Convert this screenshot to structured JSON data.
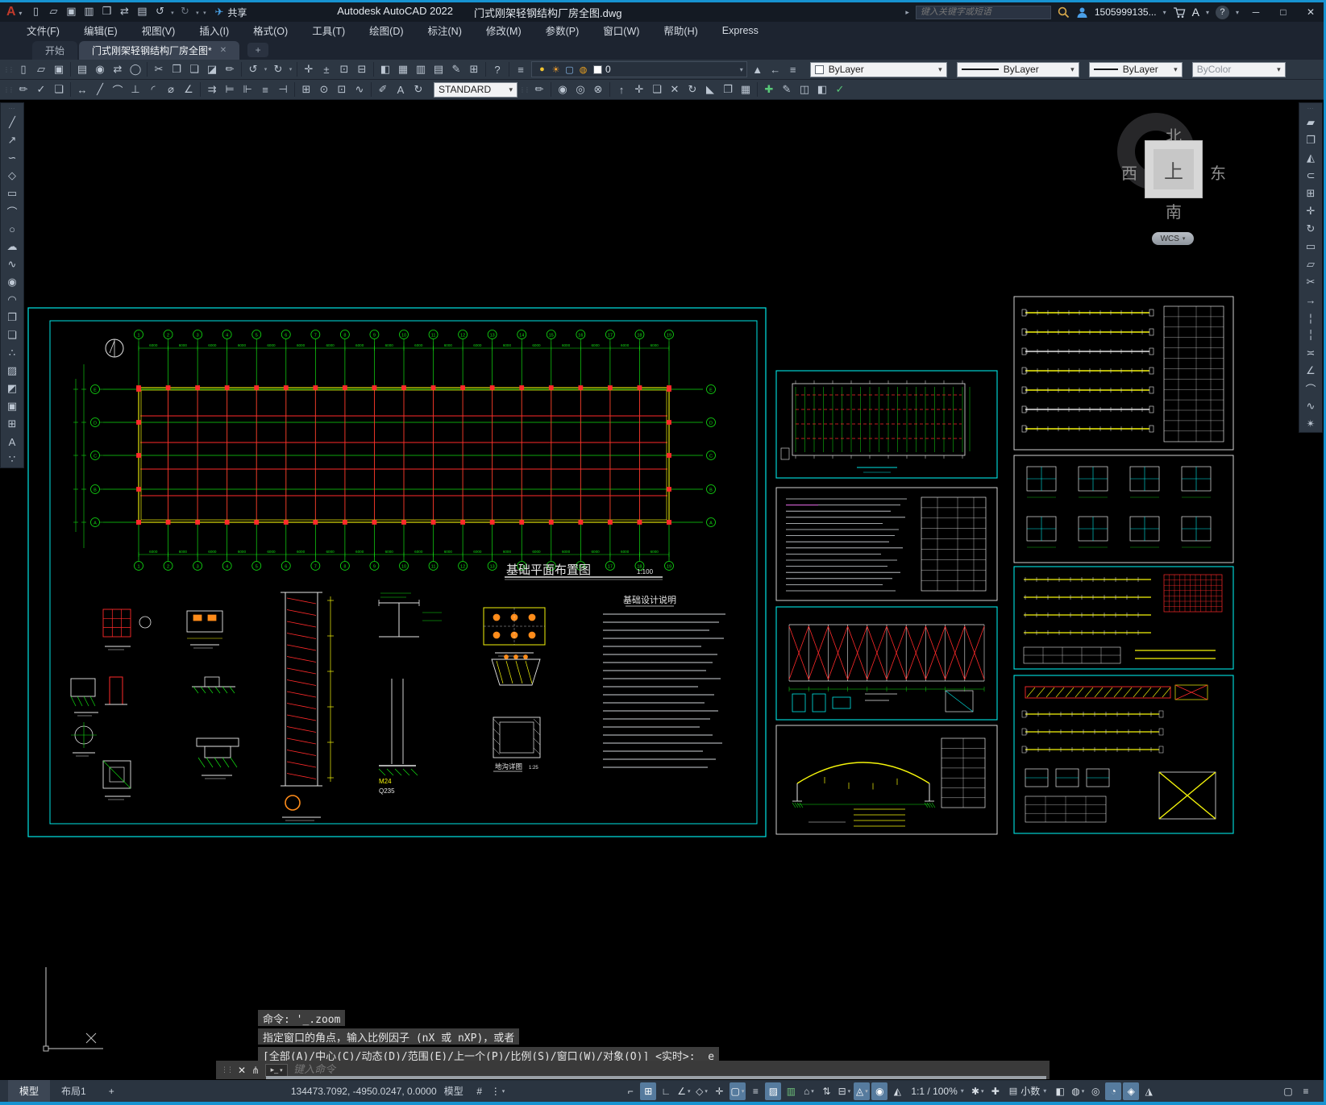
{
  "app": {
    "title": "Autodesk AutoCAD 2022",
    "file": "门式刚架轻钢结构厂房全图.dwg",
    "logo_letter": "A"
  },
  "titlebar": {
    "search_placeholder": "键入关键字或短语",
    "username": "1505999135...",
    "share_label": "共享",
    "minimize": "─",
    "maximize": "□",
    "close": "✕",
    "qat": [
      {
        "n": "qnew",
        "g": "▯"
      },
      {
        "n": "open",
        "g": "▱"
      },
      {
        "n": "qsave",
        "g": "▣"
      },
      {
        "n": "save-as",
        "g": "▥"
      },
      {
        "n": "save-to-web",
        "g": "❒"
      },
      {
        "n": "open-from-mobile",
        "g": "⇄"
      },
      {
        "n": "plot",
        "g": "▤"
      },
      {
        "n": "undo",
        "g": "↺"
      },
      {
        "n": "undo-list",
        "g": "▾",
        "sm": 1
      },
      {
        "n": "redo",
        "g": "↻",
        "c": "#6a7480"
      },
      {
        "n": "redo-list",
        "g": "▾",
        "sm": 1
      },
      {
        "n": "customize-qat",
        "g": "▾",
        "sm": 1
      }
    ]
  },
  "menu": {
    "items": [
      "文件(F)",
      "编辑(E)",
      "视图(V)",
      "插入(I)",
      "格式(O)",
      "工具(T)",
      "绘图(D)",
      "标注(N)",
      "修改(M)",
      "参数(P)",
      "窗口(W)",
      "帮助(H)",
      "Express"
    ]
  },
  "file_tabs": {
    "start": "开始",
    "doc": "门式刚架轻钢结构厂房全图*",
    "close": "✕",
    "new": "+"
  },
  "ribbon": {
    "groups1": [
      {
        "name": "file",
        "icons": [
          {
            "n": "qnew",
            "g": "▯"
          },
          {
            "n": "open",
            "g": "▱"
          },
          {
            "n": "qsave",
            "g": "▣"
          }
        ]
      },
      {
        "name": "plot",
        "icons": [
          {
            "n": "plot",
            "g": "▤"
          },
          {
            "n": "plot-preview",
            "g": "◉"
          },
          {
            "n": "publish",
            "g": "⇄"
          },
          {
            "n": "web-publish",
            "g": "◯"
          }
        ]
      },
      {
        "name": "clipboard",
        "icons": [
          {
            "n": "cut",
            "g": "✂"
          },
          {
            "n": "copy-clip",
            "g": "❐"
          },
          {
            "n": "paste",
            "g": "❏"
          },
          {
            "n": "paste-block",
            "g": "◪"
          },
          {
            "n": "match-properties",
            "g": "✏"
          }
        ]
      },
      {
        "name": "undo-redo",
        "icons": [
          {
            "n": "undo",
            "g": "↺"
          },
          {
            "n": "undo-list",
            "g": "▾",
            "sm": 1
          },
          {
            "n": "redo",
            "g": "↻"
          },
          {
            "n": "redo-list",
            "g": "▾",
            "sm": 1
          }
        ]
      },
      {
        "name": "navigate",
        "icons": [
          {
            "n": "pan",
            "g": "✛"
          },
          {
            "n": "zoom-realtime",
            "g": "±"
          },
          {
            "n": "zoom-window",
            "g": "⊡"
          },
          {
            "n": "zoom-previous",
            "g": "⊟"
          }
        ]
      },
      {
        "name": "palettes",
        "icons": [
          {
            "n": "properties",
            "g": "◧"
          },
          {
            "n": "design-center",
            "g": "▦"
          },
          {
            "n": "tool-palettes",
            "g": "▥"
          },
          {
            "n": "sheet-set-manager",
            "g": "▤"
          },
          {
            "n": "markup",
            "g": "✎"
          },
          {
            "n": "quick-calc",
            "g": "⊞"
          }
        ]
      },
      {
        "name": "help",
        "icons": [
          {
            "n": "help",
            "g": "?"
          }
        ]
      },
      {
        "name": "layer",
        "icons": [
          {
            "n": "layer-properties",
            "g": "≡"
          }
        ]
      }
    ],
    "layer_chip": {
      "icons": [
        {
          "n": "layer-on",
          "g": "●",
          "c": "#f0c330"
        },
        {
          "n": "layer-sun",
          "g": "☀",
          "c": "#f0a030"
        },
        {
          "n": "layer-vp-freeze",
          "g": "▢",
          "c": "#86b7e8"
        },
        {
          "n": "layer-lock",
          "g": "◍",
          "c": "#e8a020"
        }
      ],
      "value": "0"
    },
    "layer_tools": [
      {
        "n": "make-object-layer-current",
        "g": "▲"
      },
      {
        "n": "layer-previous",
        "g": "←"
      },
      {
        "n": "layer-states",
        "g": "≡"
      }
    ],
    "color_value": "ByLayer",
    "linetype_value": "ByLayer",
    "lineweight_value": "ByLayer",
    "plot_style_value": "ByColor",
    "text_style": "STANDARD",
    "groups2": [
      {
        "name": "text",
        "icons": [
          {
            "n": "edit-text",
            "g": "✏"
          },
          {
            "n": "spell-check",
            "g": "✓"
          },
          {
            "n": "layer-match",
            "g": "❏"
          }
        ]
      },
      {
        "name": "dimension",
        "icons": [
          {
            "n": "dim-linear",
            "g": "↔"
          },
          {
            "n": "dim-aligned",
            "g": "╱"
          },
          {
            "n": "dim-arc-length",
            "g": "⌒"
          },
          {
            "n": "dim-ordinate",
            "g": "⊥"
          },
          {
            "n": "dim-radius",
            "g": "◜"
          },
          {
            "n": "dim-diameter",
            "g": "⌀"
          },
          {
            "n": "dim-angular",
            "g": "∠"
          }
        ]
      },
      {
        "name": "dim-tools",
        "icons": [
          {
            "n": "quick-dim",
            "g": "⇉"
          },
          {
            "n": "dim-baseline",
            "g": "⊨"
          },
          {
            "n": "dim-continue",
            "g": "⊩"
          },
          {
            "n": "dim-space",
            "g": "≡"
          },
          {
            "n": "dim-break",
            "g": "⊣"
          }
        ]
      },
      {
        "name": "dim-marks",
        "icons": [
          {
            "n": "dim-insert",
            "g": "⊞"
          },
          {
            "n": "center-mark",
            "g": "⊙"
          },
          {
            "n": "tolerance",
            "g": "⊡"
          },
          {
            "n": "dim-jogged",
            "g": "∿"
          }
        ]
      },
      {
        "name": "dim-edit",
        "icons": [
          {
            "n": "dim-edit",
            "g": "✐"
          },
          {
            "n": "dim-text-edit",
            "g": "A"
          },
          {
            "n": "dim-update",
            "g": "↻"
          }
        ]
      }
    ],
    "groups2b": [
      {
        "name": "dim-style",
        "icons": [
          {
            "n": "dim-style",
            "g": "✏"
          }
        ]
      },
      {
        "name": "solids-boolean",
        "icons": [
          {
            "n": "union",
            "g": "◉"
          },
          {
            "n": "subtract",
            "g": "◎"
          },
          {
            "n": "intersect",
            "g": "⊗"
          }
        ]
      },
      {
        "name": "solids-faces",
        "icons": [
          {
            "n": "extrude-faces",
            "g": "↑"
          },
          {
            "n": "move-faces",
            "g": "✛"
          },
          {
            "n": "offset-faces",
            "g": "❏"
          },
          {
            "n": "delete-faces",
            "g": "✕"
          },
          {
            "n": "rotate-faces",
            "g": "↻"
          },
          {
            "n": "taper-faces",
            "g": "◣"
          },
          {
            "n": "copy-faces",
            "g": "❐"
          },
          {
            "n": "color-faces",
            "g": "▦"
          }
        ]
      },
      {
        "name": "solids-body",
        "icons": [
          {
            "n": "imprint",
            "g": "✚",
            "c": "#58c878"
          },
          {
            "n": "clean",
            "g": "✎"
          },
          {
            "n": "separate",
            "g": "◫"
          },
          {
            "n": "shell",
            "g": "◧"
          },
          {
            "n": "check",
            "g": "✓",
            "c": "#58c878"
          }
        ]
      }
    ]
  },
  "toolbox": {
    "draw": [
      {
        "n": "line",
        "g": "╱"
      },
      {
        "n": "construction-line",
        "g": "↗"
      },
      {
        "n": "polyline",
        "g": "∽"
      },
      {
        "n": "polygon",
        "g": "◇"
      },
      {
        "n": "rectangle",
        "g": "▭"
      },
      {
        "n": "arc",
        "g": "⌒"
      },
      {
        "n": "circle",
        "g": "○"
      },
      {
        "n": "revision-cloud",
        "g": "☁"
      },
      {
        "n": "spline",
        "g": "∿"
      },
      {
        "n": "ellipse",
        "g": "◉"
      },
      {
        "n": "ellipse-arc",
        "g": "◠"
      },
      {
        "n": "insert-block",
        "g": "❐"
      },
      {
        "n": "make-block",
        "g": "❏"
      },
      {
        "n": "point",
        "g": "∴"
      },
      {
        "n": "hatch",
        "g": "▨"
      },
      {
        "n": "gradient",
        "g": "◩"
      },
      {
        "n": "region",
        "g": "▣"
      },
      {
        "n": "table",
        "g": "⊞"
      },
      {
        "n": "multiline-text",
        "g": "A"
      },
      {
        "n": "divide",
        "g": "∵"
      }
    ],
    "modify": [
      {
        "n": "erase",
        "g": "▰"
      },
      {
        "n": "copy",
        "g": "❐"
      },
      {
        "n": "mirror",
        "g": "◭"
      },
      {
        "n": "offset",
        "g": "⊂"
      },
      {
        "n": "array",
        "g": "⊞"
      },
      {
        "n": "move",
        "g": "✛"
      },
      {
        "n": "rotate",
        "g": "↻"
      },
      {
        "n": "scale",
        "g": "▭"
      },
      {
        "n": "stretch",
        "g": "▱"
      },
      {
        "n": "trim",
        "g": "✂"
      },
      {
        "n": "extend",
        "g": "→"
      },
      {
        "n": "break-at-point",
        "g": "¦"
      },
      {
        "n": "break",
        "g": "╎"
      },
      {
        "n": "join",
        "g": "≍"
      },
      {
        "n": "chamfer",
        "g": "∠"
      },
      {
        "n": "fillet",
        "g": "⌒"
      },
      {
        "n": "blend-curves",
        "g": "∿"
      },
      {
        "n": "explode",
        "g": "✴"
      }
    ]
  },
  "viewcube": {
    "north": "北",
    "south": "南",
    "east": "东",
    "west": "西",
    "top": "上",
    "wcs": "WCS"
  },
  "drawing": {
    "plan_title": "基础平面布置图",
    "plan_scale": "1:100",
    "notes_title": "基础设计说明",
    "trench_title": "地沟详图",
    "trench_scale": "1:25",
    "bolt_label": "M24",
    "steel_label": "Q235",
    "dim_label": "6000",
    "col_axis_labels": [
      "1",
      "2",
      "3",
      "4",
      "5",
      "6",
      "7",
      "8",
      "9",
      "10",
      "11",
      "12",
      "13",
      "14",
      "15",
      "16",
      "17",
      "18",
      "19"
    ],
    "row_axis_labels": [
      "A",
      "B",
      "C",
      "D",
      "E"
    ]
  },
  "command": {
    "history": [
      "命令: '_.zoom",
      "指定窗口的角点，输入比例因子 (nX 或 nXP)，或者",
      "[全部(A)/中心(C)/动态(D)/范围(E)/上一个(P)/比例(S)/窗口(W)/对象(O)] <实时>: _e"
    ],
    "input_placeholder": "键入命令",
    "close": "✕"
  },
  "statusbar": {
    "model_tab": "模型",
    "layout_tab": "布局1",
    "new_layout_tab": "+",
    "coordinates": "134473.7092, -4950.0247, 0.0000",
    "model_toggle": "模型",
    "grid_glyph": "#",
    "snap_glyph": "⋮",
    "scale_value": "1:1 / 100%",
    "units_value": "小数",
    "icons": [
      {
        "n": "model-paper",
        "g": "⌐"
      },
      {
        "n": "snap-mode",
        "g": "⊞",
        "a": 1
      },
      {
        "n": "ortho",
        "g": "∟"
      },
      {
        "n": "polar-tracking",
        "g": "∠",
        "d": 1
      },
      {
        "n": "isodraft",
        "g": "◇",
        "d": 1
      },
      {
        "n": "object-snap-tracking",
        "g": "✛"
      },
      {
        "n": "object-snap",
        "g": "▢",
        "a": 1,
        "d": 1
      },
      {
        "n": "lineweight-display",
        "g": "≡"
      },
      {
        "n": "transparency",
        "g": "▨",
        "a": 1
      },
      {
        "n": "selection-cycling",
        "g": "▥",
        "c": "#6fc07a"
      },
      {
        "n": "object-snap-3d",
        "g": "⌂",
        "d": 1
      },
      {
        "n": "dynamic-ucs",
        "g": "⇅"
      },
      {
        "n": "dynamic-input",
        "g": "⊟",
        "d": 1
      },
      {
        "n": "annotation-monitor",
        "g": "◬",
        "a": 1,
        "d": 1
      },
      {
        "n": "annotation-visibility",
        "g": "◉",
        "a": 1
      },
      {
        "n": "annotation-autoscale",
        "g": "◭"
      }
    ],
    "icons2": [
      {
        "n": "workspace-settings",
        "g": "✱",
        "d": 1
      },
      {
        "n": "object-isolate",
        "g": "✚"
      }
    ],
    "icons3": [
      {
        "n": "quick-properties",
        "g": "◧"
      },
      {
        "n": "lock-ui",
        "g": "◍",
        "d": 1
      },
      {
        "n": "isolate-objects",
        "g": "◎"
      },
      {
        "n": "graphics-performance",
        "g": "◔",
        "a": 1
      },
      {
        "n": "autosave-monitor",
        "g": "◈",
        "a": 1
      },
      {
        "n": "performance-recorder",
        "g": "◮"
      }
    ],
    "icons4": [
      {
        "n": "clean-screen",
        "g": "▢"
      },
      {
        "n": "customization-menu",
        "g": "≡"
      }
    ]
  },
  "colors": {
    "accent_blue": "#1793d1",
    "highlight_blue": "#567b9e",
    "cad_green": "#12dd12",
    "cad_red": "#ff2a2a",
    "cad_yellow": "#f5f50a",
    "cad_cyan": "#00e5e5",
    "cad_white": "#e6e6e6"
  }
}
